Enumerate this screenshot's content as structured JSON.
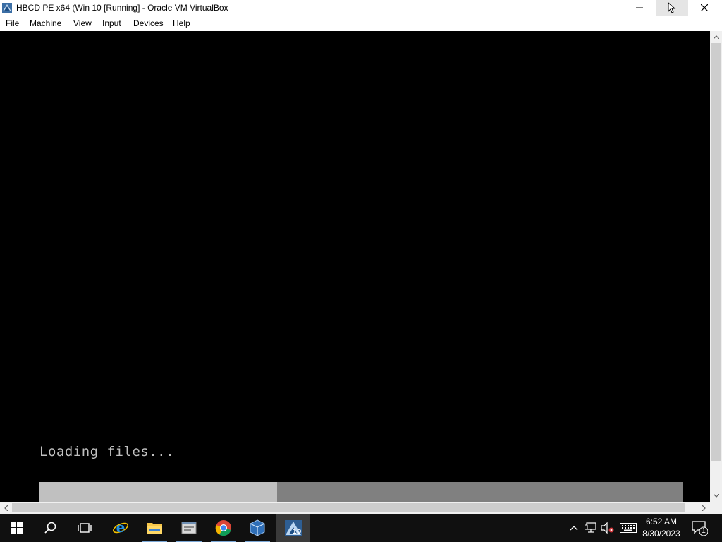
{
  "window": {
    "title": "HBCD PE x64 (Win 10 [Running] - Oracle VM VirtualBox"
  },
  "menu": {
    "items": [
      "File",
      "Machine",
      "View",
      "Input",
      "Devices",
      "Help"
    ]
  },
  "vm": {
    "loading_text": "Loading files...",
    "progress_fraction": 0.37
  },
  "taskbar": {
    "clock_time": "6:52 AM",
    "clock_date": "8/30/2023",
    "notification_count": "1",
    "apps": [
      "start",
      "search",
      "task-view",
      "internet-explorer",
      "file-explorer",
      "app-window",
      "chrome",
      "virtualbox",
      "virtualbox-vm"
    ]
  },
  "colors": {
    "taskbar": "#101010",
    "vm_background": "#000000",
    "progress_fill": "#c0c0c0",
    "progress_track": "#808080",
    "accent": "#7aa7d6"
  }
}
